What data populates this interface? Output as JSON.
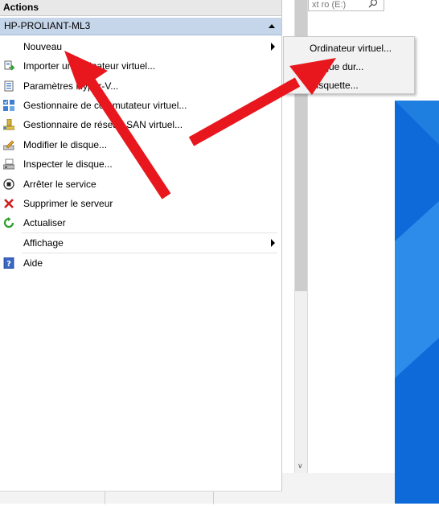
{
  "actions_pane": {
    "title": "Actions",
    "server_name": "HP-PROLIANT-ML3",
    "items": [
      {
        "label": "Nouveau",
        "icon": "none",
        "has_submenu": true
      },
      {
        "label": "Importer un ordinateur virtuel...",
        "icon": "import-vm-icon",
        "has_submenu": false
      },
      {
        "label": "Paramètres Hyper-V...",
        "icon": "settings-icon",
        "has_submenu": false
      },
      {
        "label": "Gestionnaire de commutateur virtuel...",
        "icon": "switch-manager-icon",
        "has_submenu": false
      },
      {
        "label": "Gestionnaire de réseau SAN virtuel...",
        "icon": "san-manager-icon",
        "has_submenu": false
      },
      {
        "label": "Modifier le disque...",
        "icon": "edit-disk-icon",
        "has_submenu": false
      },
      {
        "label": "Inspecter le disque...",
        "icon": "inspect-disk-icon",
        "has_submenu": false
      },
      {
        "label": "Arrêter le service",
        "icon": "stop-icon",
        "has_submenu": false
      },
      {
        "label": "Supprimer le serveur",
        "icon": "delete-icon",
        "has_submenu": false
      },
      {
        "label": "Actualiser",
        "icon": "refresh-icon",
        "has_submenu": false
      },
      {
        "label": "Affichage",
        "icon": "none",
        "has_submenu": true
      },
      {
        "label": "Aide",
        "icon": "help-icon",
        "has_submenu": false
      }
    ]
  },
  "submenu": {
    "items": [
      {
        "label": "Ordinateur virtuel..."
      },
      {
        "label": "Disque dur..."
      },
      {
        "label": "Disquette..."
      }
    ]
  },
  "background": {
    "search_placeholder": "xt ro (E:)"
  },
  "colors": {
    "server_header_bg": "#c6d6ea",
    "annotation_arrow": "#e8171d",
    "desktop_blue": "#1f7fe0"
  }
}
